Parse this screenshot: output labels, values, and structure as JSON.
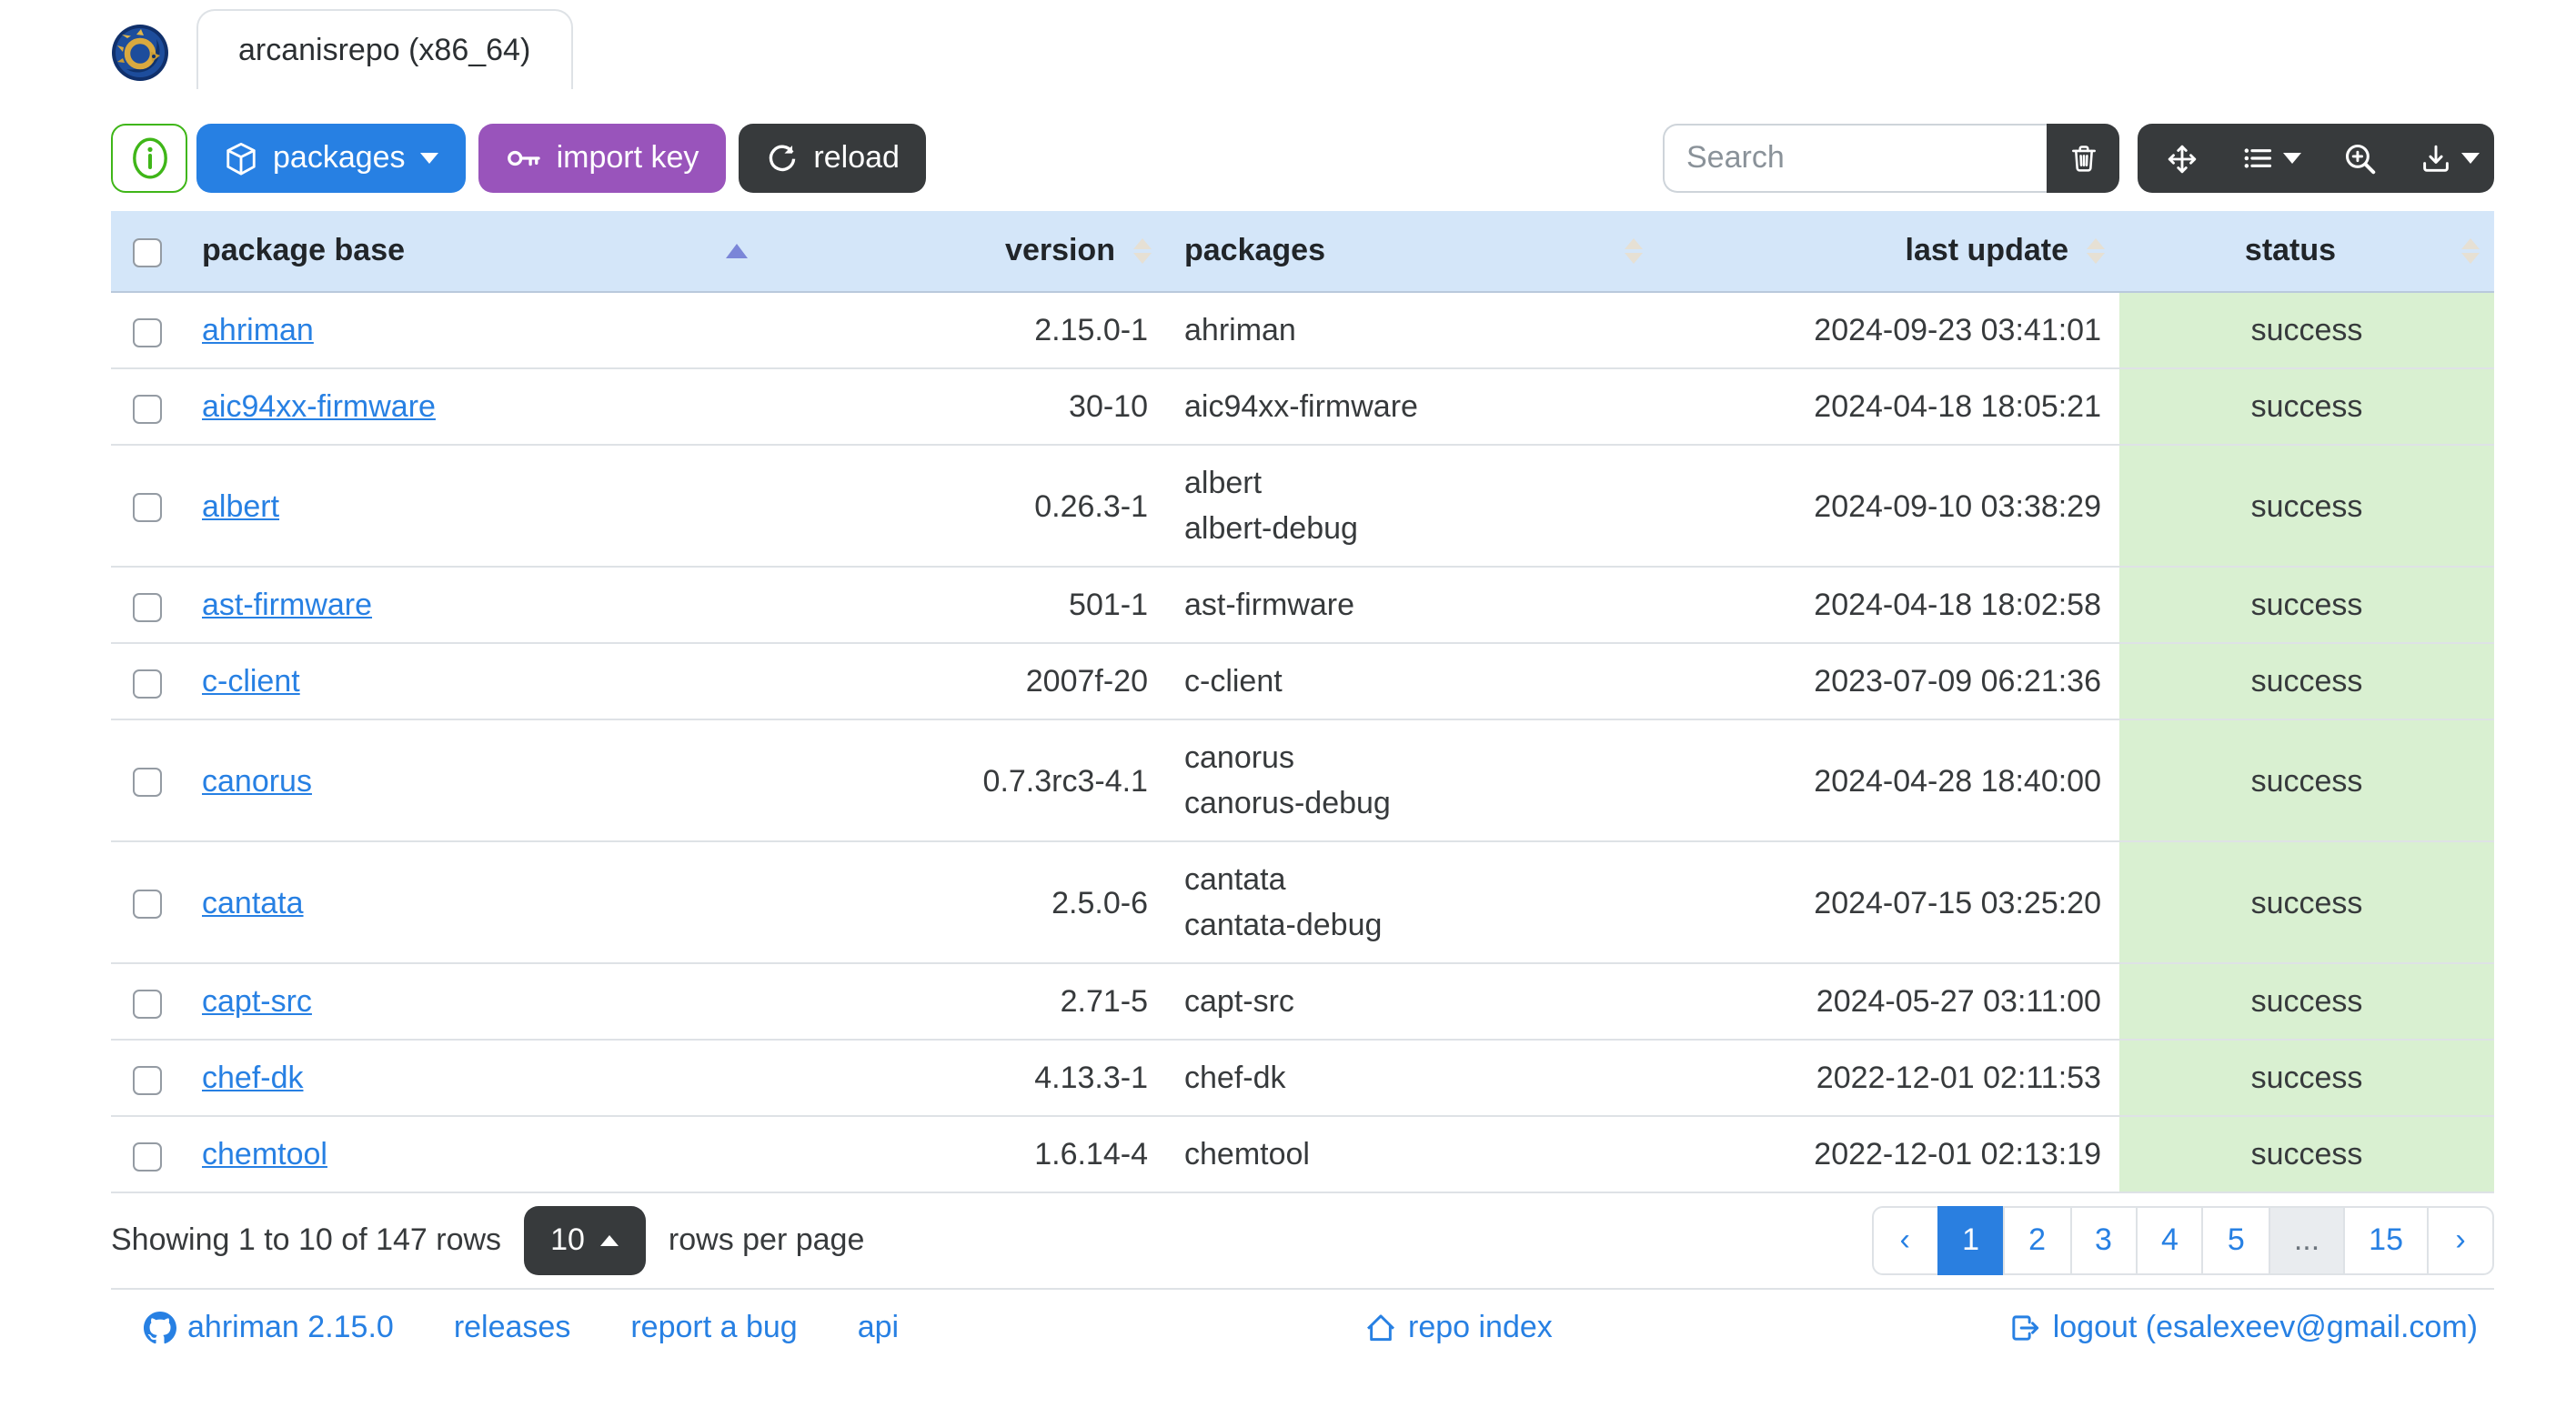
{
  "window": {
    "tab_title": "arcanisrepo (x86_64)"
  },
  "toolbar": {
    "packages_label": "packages",
    "import_key_label": "import key",
    "reload_label": "reload",
    "search_placeholder": "Search"
  },
  "table": {
    "columns": [
      "package base",
      "version",
      "packages",
      "last update",
      "status"
    ],
    "sort": {
      "column": "package base",
      "order": "asc"
    },
    "rows": [
      {
        "base": "ahriman",
        "version": "2.15.0-1",
        "packages": [
          "ahriman"
        ],
        "last_update": "2024-09-23 03:41:01",
        "status": "success"
      },
      {
        "base": "aic94xx-firmware",
        "version": "30-10",
        "packages": [
          "aic94xx-firmware"
        ],
        "last_update": "2024-04-18 18:05:21",
        "status": "success"
      },
      {
        "base": "albert",
        "version": "0.26.3-1",
        "packages": [
          "albert",
          "albert-debug"
        ],
        "last_update": "2024-09-10 03:38:29",
        "status": "success"
      },
      {
        "base": "ast-firmware",
        "version": "501-1",
        "packages": [
          "ast-firmware"
        ],
        "last_update": "2024-04-18 18:02:58",
        "status": "success"
      },
      {
        "base": "c-client",
        "version": "2007f-20",
        "packages": [
          "c-client"
        ],
        "last_update": "2023-07-09 06:21:36",
        "status": "success"
      },
      {
        "base": "canorus",
        "version": "0.7.3rc3-4.1",
        "packages": [
          "canorus",
          "canorus-debug"
        ],
        "last_update": "2024-04-28 18:40:00",
        "status": "success"
      },
      {
        "base": "cantata",
        "version": "2.5.0-6",
        "packages": [
          "cantata",
          "cantata-debug"
        ],
        "last_update": "2024-07-15 03:25:20",
        "status": "success"
      },
      {
        "base": "capt-src",
        "version": "2.71-5",
        "packages": [
          "capt-src"
        ],
        "last_update": "2024-05-27 03:11:00",
        "status": "success"
      },
      {
        "base": "chef-dk",
        "version": "4.13.3-1",
        "packages": [
          "chef-dk"
        ],
        "last_update": "2022-12-01 02:11:53",
        "status": "success"
      },
      {
        "base": "chemtool",
        "version": "1.6.14-4",
        "packages": [
          "chemtool"
        ],
        "last_update": "2022-12-01 02:13:19",
        "status": "success"
      }
    ]
  },
  "pagination": {
    "summary": "Showing 1 to 10 of 147 rows",
    "page_size": "10",
    "rows_per_page_label": "rows per page",
    "items": [
      {
        "label": "‹",
        "type": "prev"
      },
      {
        "label": "1",
        "type": "page",
        "active": true
      },
      {
        "label": "2",
        "type": "page"
      },
      {
        "label": "3",
        "type": "page"
      },
      {
        "label": "4",
        "type": "page"
      },
      {
        "label": "5",
        "type": "page"
      },
      {
        "label": "...",
        "type": "ellipsis"
      },
      {
        "label": "15",
        "type": "page"
      },
      {
        "label": "›",
        "type": "next"
      }
    ]
  },
  "footer": {
    "version_link": "ahriman 2.15.0",
    "releases_link": "releases",
    "report_bug_link": "report a bug",
    "api_link": "api",
    "repo_index_link": "repo index",
    "logout_link": "logout (esalexeev@gmail.com)"
  },
  "colors": {
    "primary": "#2780e3",
    "purple": "#9954bb",
    "dark": "#373a3c",
    "success_green": "#3fb618",
    "table_header_bg": "#d4e6f9",
    "status_cell_bg": "#d9f0d1",
    "sort_active_arrow": "#7b86d8"
  }
}
